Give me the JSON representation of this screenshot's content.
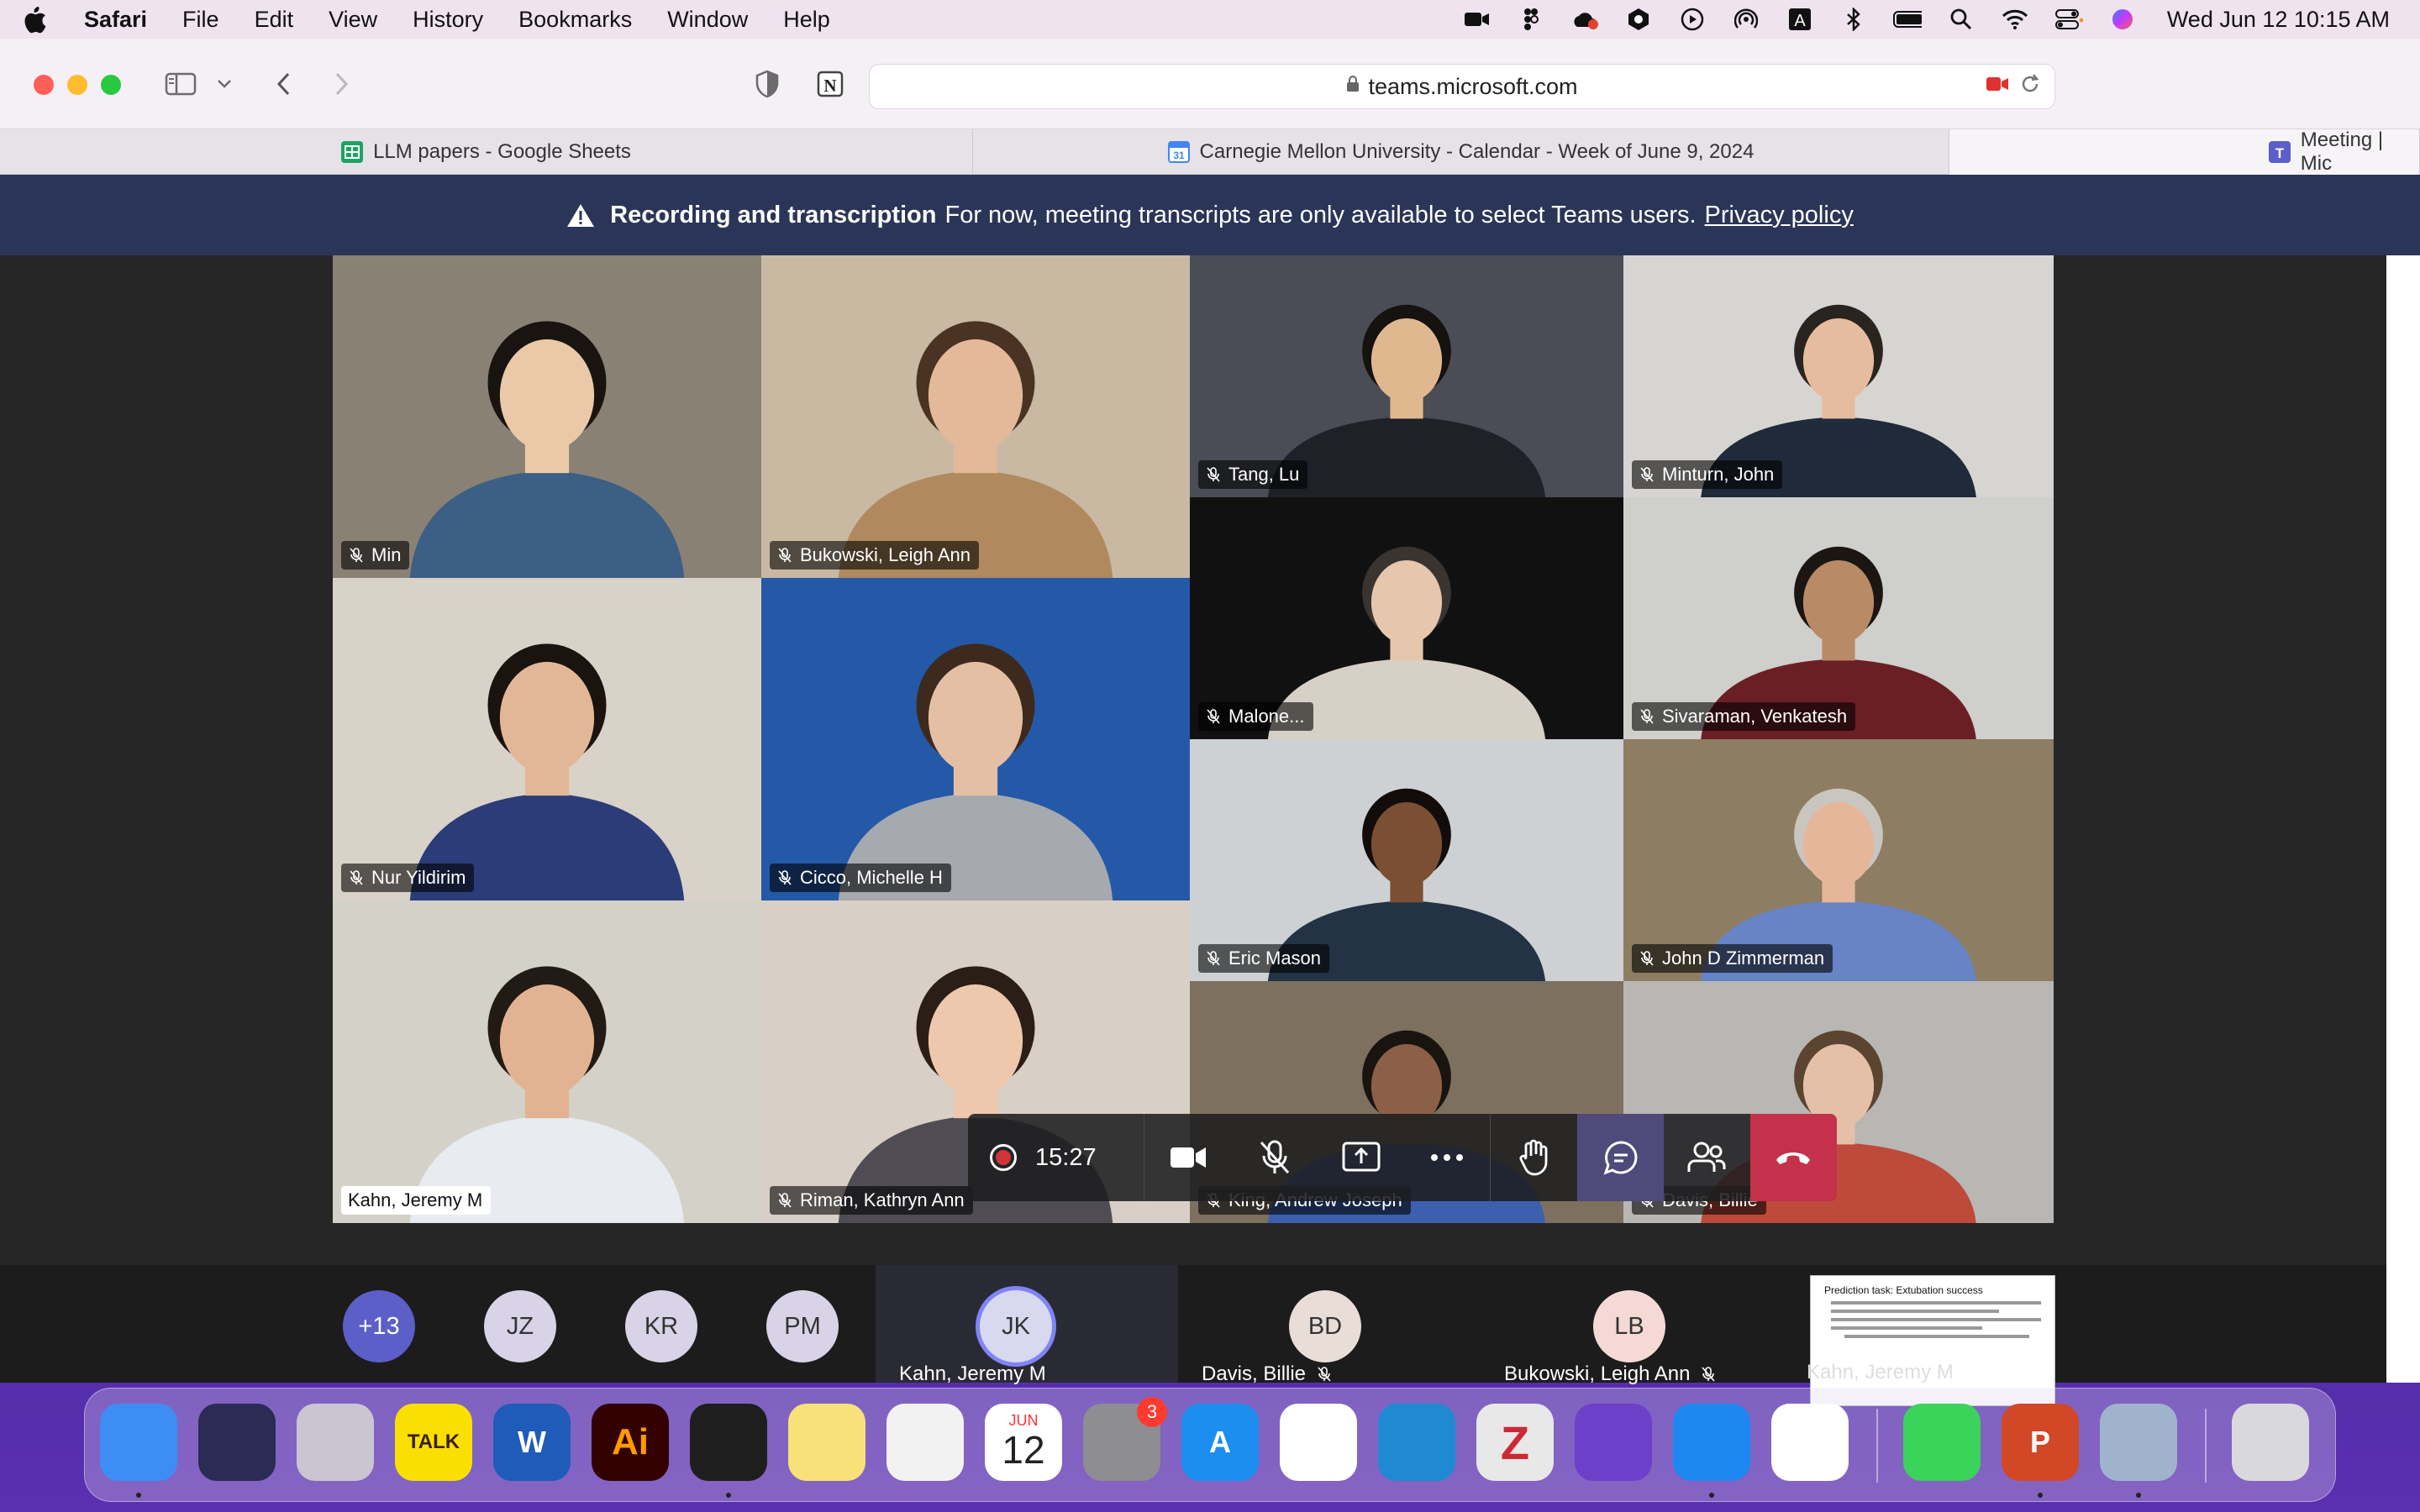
{
  "menubar": {
    "app": "Safari",
    "items": [
      "File",
      "Edit",
      "View",
      "History",
      "Bookmarks",
      "Window",
      "Help"
    ],
    "clock": "Wed Jun 12  10:15 AM",
    "status_icons": [
      "camera-status-icon",
      "figma-status-icon",
      "creative-cloud-icon",
      "perplexity-icon",
      "play-icon",
      "airdrop-icon",
      "a-icon",
      "bluetooth-icon",
      "battery-icon",
      "search-icon",
      "wifi-icon",
      "control-center-icon",
      "siri-icon"
    ]
  },
  "browser": {
    "url": "teams.microsoft.com",
    "tabs": [
      {
        "title": "LLM papers - Google Sheets",
        "favicon_color": "#1ea362"
      },
      {
        "title": "Carnegie Mellon University - Calendar - Week of June 9, 2024",
        "favicon_color": "#4285f4"
      },
      {
        "title": "Meeting | Mic",
        "favicon_color": "#5b5fc7"
      }
    ]
  },
  "banner": {
    "title": "Recording and transcription",
    "message": "For now, meeting transcripts are only available to select Teams users.",
    "link": "Privacy policy"
  },
  "participants": [
    {
      "name": "Min",
      "muted": true,
      "bg": "#8a8175",
      "skin": "#e9c9a8",
      "shirt": "#3b5f85",
      "hair": "#1a1410"
    },
    {
      "name": "Bukowski, Leigh Ann",
      "muted": true,
      "bg": "#c9b9a3",
      "skin": "#e3b99a",
      "shirt": "#b08a5e",
      "hair": "#4a3322"
    },
    {
      "name": "Tang, Lu",
      "muted": true,
      "bg": "#4a4d55",
      "skin": "#e0b890",
      "shirt": "#1e2228",
      "hair": "#15120f"
    },
    {
      "name": "Minturn, John",
      "muted": true,
      "bg": "#d6d5d2",
      "skin": "#e6bca0",
      "shirt": "#1f2a3a",
      "hair": "#2a2420"
    },
    {
      "name": "Nur Yildirim",
      "muted": true,
      "bg": "#d9d2c9",
      "skin": "#e2b797",
      "shirt": "#2b3c78",
      "hair": "#1a130e"
    },
    {
      "name": "Cicco, Michelle H",
      "muted": true,
      "bg": "#2459a8",
      "skin": "#e5bfa3",
      "shirt": "#a6a9ae",
      "hair": "#3d2a1c"
    },
    {
      "name": "Malone...",
      "muted": true,
      "bg": "#111111",
      "skin": "#e6c6ad",
      "shirt": "#d7d0c6",
      "hair": "#3a3430"
    },
    {
      "name": "Sivaraman, Venkatesh",
      "muted": true,
      "bg": "#cfcfcb",
      "skin": "#b98a66",
      "shirt": "#6b1f24",
      "hair": "#1b1612"
    },
    {
      "name": "Eric Mason",
      "muted": true,
      "bg": "#cdd1d4",
      "skin": "#7a4f33",
      "shirt": "#233244",
      "hair": "#120d0a"
    },
    {
      "name": "John D Zimmerman",
      "muted": true,
      "bg": "#8d7d62",
      "skin": "#e6b69b",
      "shirt": "#6684c6",
      "hair": "#c9c6c0"
    },
    {
      "name": "Kahn, Jeremy M",
      "muted": false,
      "bg": "#d4d1c8",
      "skin": "#e2b393",
      "shirt": "#e8ebef",
      "hair": "#221a14"
    },
    {
      "name": "Riman, Kathryn Ann",
      "muted": true,
      "bg": "#d8d0c6",
      "skin": "#edc8ac",
      "shirt": "#4f4c54",
      "hair": "#2a1e16"
    },
    {
      "name": "King, Andrew Joseph",
      "muted": true,
      "bg": "#7e705f",
      "skin": "#8c6047",
      "shirt": "#3c5fae",
      "hair": "#1a1410"
    },
    {
      "name": "Davis, Billie",
      "muted": true,
      "bg": "#b9b7b3",
      "skin": "#e5c0a8",
      "shirt": "#bd4a3a",
      "hair": "#5b4430"
    }
  ],
  "controls": {
    "timer": "15:27",
    "buttons": [
      "camera-button",
      "mute-button",
      "share-button",
      "more-button",
      "raise-hand-button",
      "chat-button",
      "people-button",
      "hang-up-button"
    ]
  },
  "strip": {
    "more": "+13",
    "avatars": [
      "JZ",
      "KR",
      "PM"
    ],
    "spotlight": {
      "initials": "JK",
      "name": "Kahn, Jeremy M"
    },
    "others": [
      {
        "initials": "BD",
        "name": "Davis, Billie",
        "muted": true
      },
      {
        "initials": "LB",
        "name": "Bukowski, Leigh Ann",
        "muted": true
      }
    ],
    "share": {
      "name": "Kahn, Jeremy M",
      "slide_title": "Prediction task: Extubation success"
    }
  },
  "dock": {
    "apps": [
      {
        "name": "Finder",
        "label": "",
        "color": "#3d8df5",
        "running": true
      },
      {
        "name": "Siri",
        "label": "",
        "color": "#2b2b55",
        "running": false
      },
      {
        "name": "Launchpad",
        "label": "",
        "color": "#c9c6d2",
        "running": false
      },
      {
        "name": "KakaoTalk",
        "label": "TALK",
        "color": "#f9e000",
        "running": false
      },
      {
        "name": "Word",
        "label": "W",
        "color": "#1f5bb8",
        "running": false
      },
      {
        "name": "Illustrator",
        "label": "Ai",
        "color": "#330000",
        "running": false
      },
      {
        "name": "Figma",
        "label": "",
        "color": "#1e1e1e",
        "running": true
      },
      {
        "name": "Notes",
        "label": "",
        "color": "#f7e27a",
        "running": false
      },
      {
        "name": "Cursor",
        "label": "",
        "color": "#f2f2f2",
        "running": false
      },
      {
        "name": "Calendar",
        "label": "12",
        "month": "JUN",
        "color": "#ffffff",
        "running": false
      },
      {
        "name": "System Settings",
        "label": "",
        "color": "#8d8d92",
        "badge": "3",
        "running": false
      },
      {
        "name": "App Store",
        "label": "A",
        "color": "#1c8ef0",
        "running": false
      },
      {
        "name": "Slack",
        "label": "",
        "color": "#ffffff",
        "running": false
      },
      {
        "name": "VS Code",
        "label": "",
        "color": "#1f8ad2",
        "running": false
      },
      {
        "name": "Zotero",
        "label": "Z",
        "color": "#e8e8e8",
        "running": false
      },
      {
        "name": "GitHub Desktop",
        "label": "",
        "color": "#6e40c9",
        "running": false
      },
      {
        "name": "Safari",
        "label": "",
        "color": "#1e88f0",
        "running": true
      },
      {
        "name": "Chrome",
        "label": "",
        "color": "#ffffff",
        "running": false
      },
      {
        "name": "Messages",
        "label": "",
        "color": "#3bd35a",
        "running": false
      },
      {
        "name": "PowerPoint",
        "label": "P",
        "color": "#d24726",
        "running": true
      },
      {
        "name": "Preview",
        "label": "",
        "color": "#9fb4cc",
        "running": true
      },
      {
        "name": "Trash",
        "label": "",
        "color": "#d9d9dc",
        "running": false
      }
    ]
  }
}
